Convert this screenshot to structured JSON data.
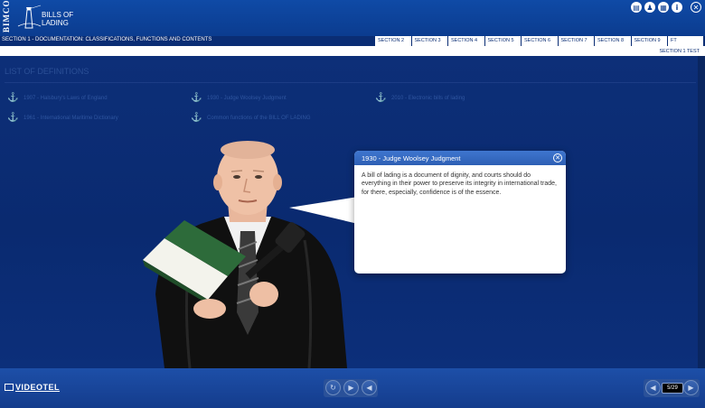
{
  "header": {
    "brand": "BIMCO",
    "product_line1": "BILLS OF",
    "product_line2": "LADING",
    "icons": [
      "print-icon",
      "people-icon",
      "book-icon",
      "info-icon",
      "close-icon"
    ],
    "icon_glyphs": [
      "▤",
      "♟",
      "▦",
      "i",
      "✕"
    ]
  },
  "section_bar": {
    "title": "SECTION 1 - DOCUMENTATION: CLASSIFICATIONS, FUNCTIONS AND CONTENTS",
    "tabs": [
      "SECTION 2",
      "SECTION 3",
      "SECTION 4",
      "SECTION 5",
      "SECTION 6",
      "SECTION 7",
      "SECTION 8",
      "SECTION 9",
      "FT"
    ],
    "test_label": "SECTION 1 TEST"
  },
  "main": {
    "list_title": "LIST OF DEFINITIONS",
    "definitions": [
      "1907 - Halsbury's Laws of England",
      "1930 - Judge Woolsey Judgment",
      "2010 - Electronic bills of lading",
      "1961 - International Maritime Dictionary",
      "Common functions of the BILL OF LADING"
    ]
  },
  "dialog": {
    "title": "1930 - Judge Woolsey Judgment",
    "body": "A bill of lading is a document of dignity, and courts should do everything in their power to preserve its integrity in international trade, for there, especially, confidence is of the essence."
  },
  "footer": {
    "brand": "VIDEOTEL",
    "replay_glyph": "↻",
    "play_glyph": "▶",
    "audio_glyph": "◀",
    "prev_glyph": "◀",
    "next_glyph": "▶",
    "page_indicator": "5/29"
  }
}
